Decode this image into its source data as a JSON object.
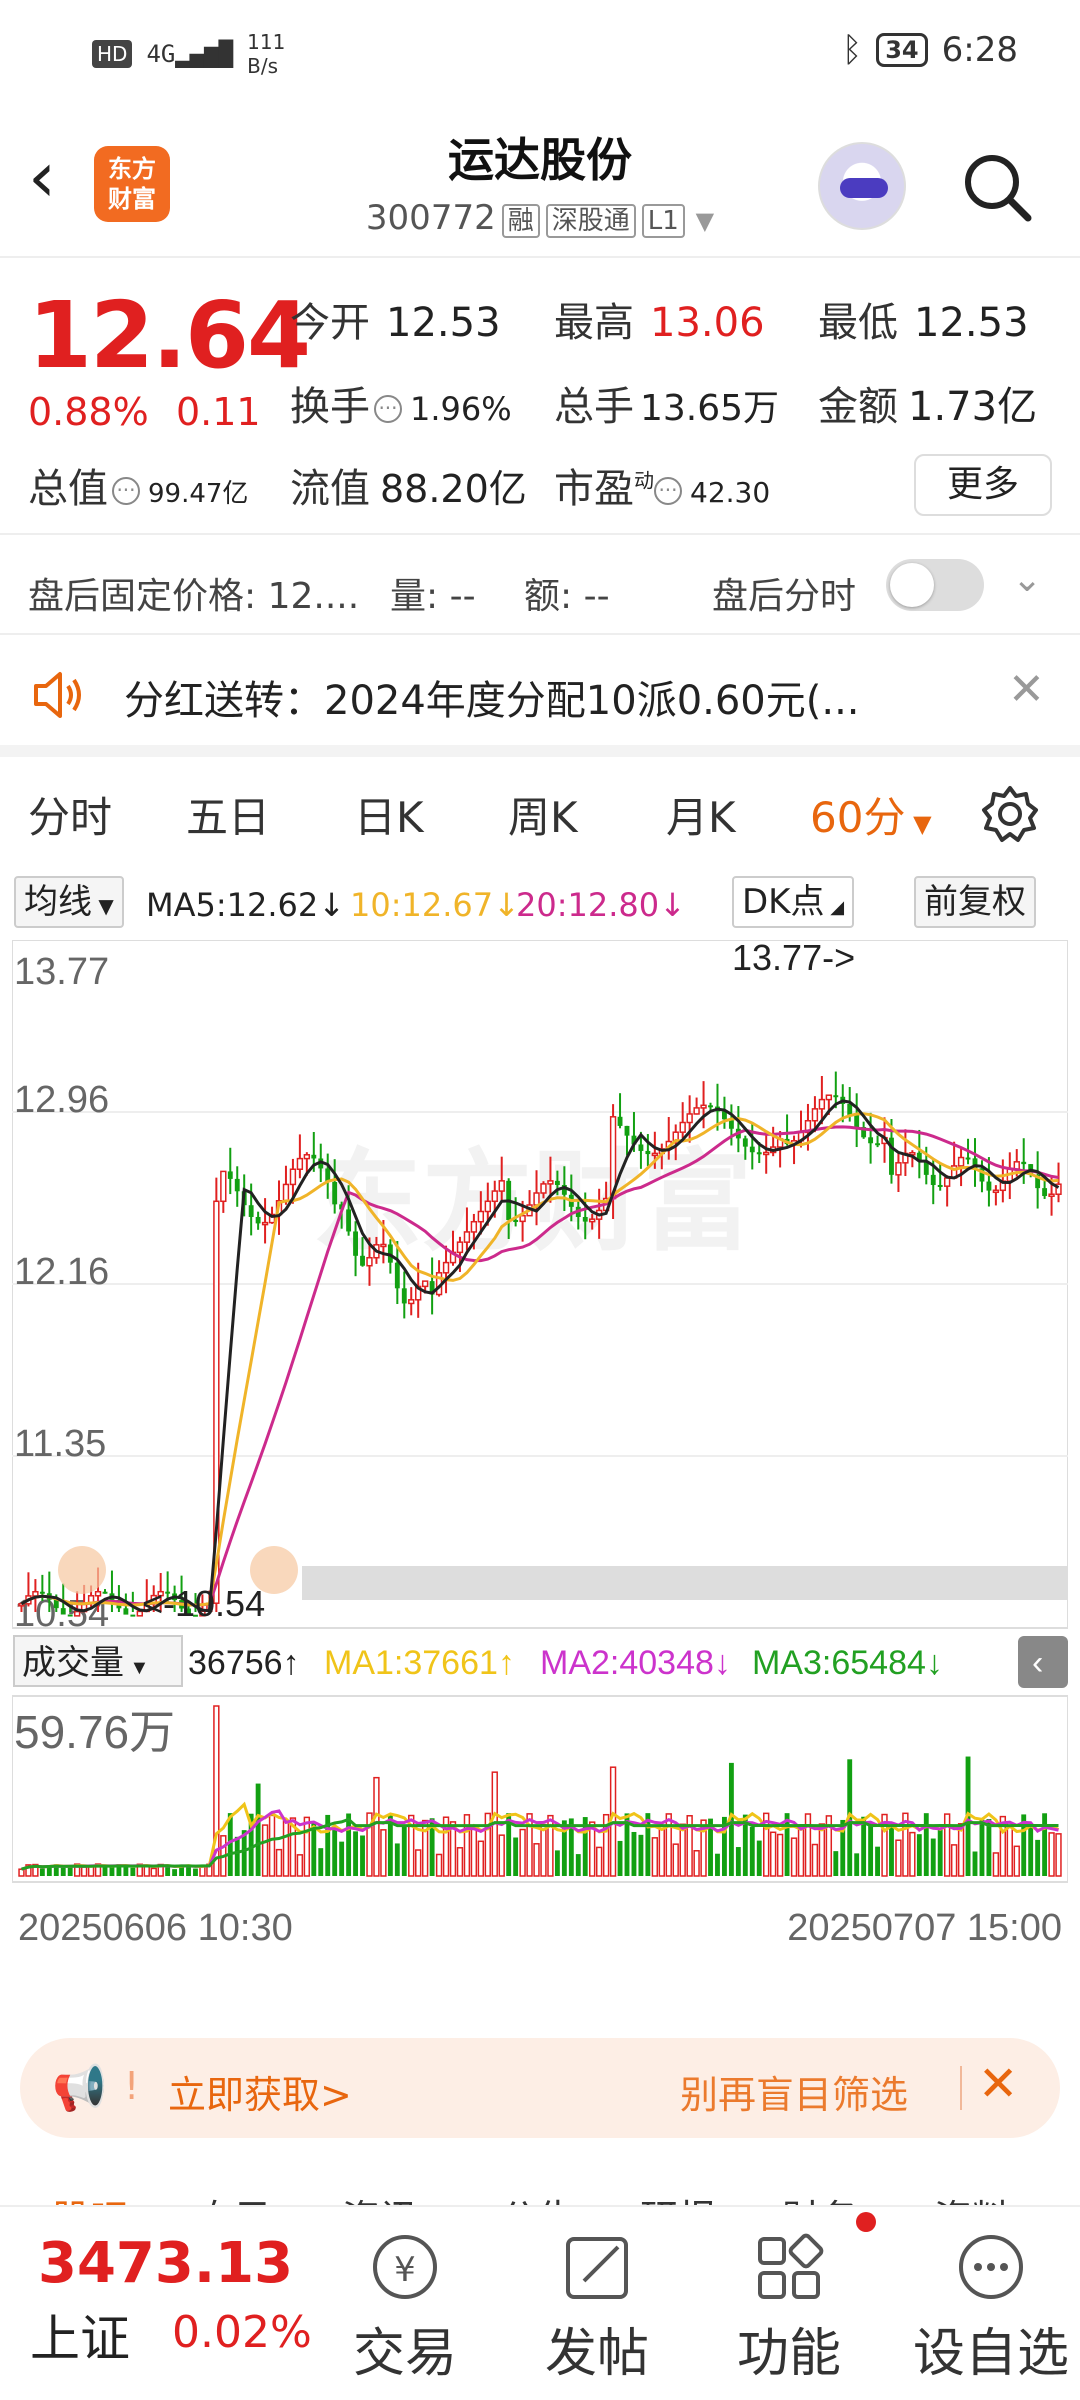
{
  "status_bar": {
    "left_badge": "HD",
    "signal": "4G",
    "net_speed_value": "111",
    "net_speed_unit": "B/s",
    "battery": "34",
    "time": "6:28"
  },
  "header": {
    "logo_line1": "东方",
    "logo_line2": "财富",
    "title": "运达股份",
    "code": "300772",
    "tags": [
      "融",
      "深股通",
      "L1"
    ]
  },
  "quote": {
    "price": "12.64",
    "change_pct": "0.88%",
    "change_amt": "0.11",
    "open_label": "今开",
    "open": "12.53",
    "high_label": "最高",
    "high": "13.06",
    "low_label": "最低",
    "low": "12.53",
    "turnover_label": "换手",
    "turnover": "1.96%",
    "volume_label": "总手",
    "volume": "13.65万",
    "amount_label": "金额",
    "amount": "1.73亿",
    "mktcap_label": "总值",
    "mktcap": "99.47亿",
    "float_label": "流值",
    "float_cap": "88.20亿",
    "pe_label": "市盈",
    "pe_sup": "动",
    "pe": "42.30",
    "more": "更多"
  },
  "after_hours": {
    "fixed_price": "盘后固定价格: 12....",
    "volume": "量: --",
    "amount": "额: --",
    "chart_toggle": "盘后分时"
  },
  "dividend": {
    "text": "分红送转：2024年度分配10派0.60元(..."
  },
  "period_tabs": [
    "分时",
    "五日",
    "日K",
    "周K",
    "月K",
    "60分"
  ],
  "ma_bar": {
    "selector": "均线",
    "ma5": "MA5:12.62↓",
    "ma10": "10:12.67↓",
    "ma20": "20:12.80↓",
    "dk": "DK点",
    "adjust": "前复权"
  },
  "colors": {
    "up": "#e02020",
    "down": "#12a012",
    "ma5": "#222222",
    "ma10": "#f0b429",
    "ma20": "#cc2a8c",
    "accent": "#e8660e"
  },
  "chart_data": {
    "type": "candlestick",
    "y_ticks": [
      "13.77",
      "12.96",
      "12.16",
      "11.35",
      "10.54"
    ],
    "ylim": [
      10.54,
      13.77
    ],
    "max_marker": "13.77->",
    "min_marker": "<-10.54",
    "x_start": "20250606 10:30",
    "x_end": "20250707 15:00",
    "watermark": "东方财富"
  },
  "volume": {
    "selector": "成交量",
    "value": "36756↑",
    "ma1": "MA1:37661↑",
    "ma2": "MA2:40348↓",
    "ma3": "MA3:65484↓",
    "max_label": "59.76万",
    "colors": {
      "ma1": "#f0c419",
      "ma2": "#cc33cc",
      "ma3": "#22a022"
    }
  },
  "promo": {
    "cta": "立即获取>",
    "slogan": "别再盲目筛选"
  },
  "bottom_tabs_hint": [
    "股吧",
    "自己",
    "资讯",
    "公告",
    "研报",
    "财务",
    "资料"
  ],
  "bottom_nav": {
    "index_value": "3473.13",
    "index_name": "上证",
    "index_pct": "0.02%",
    "items": [
      "交易",
      "发帖",
      "功能",
      "设自选"
    ]
  }
}
